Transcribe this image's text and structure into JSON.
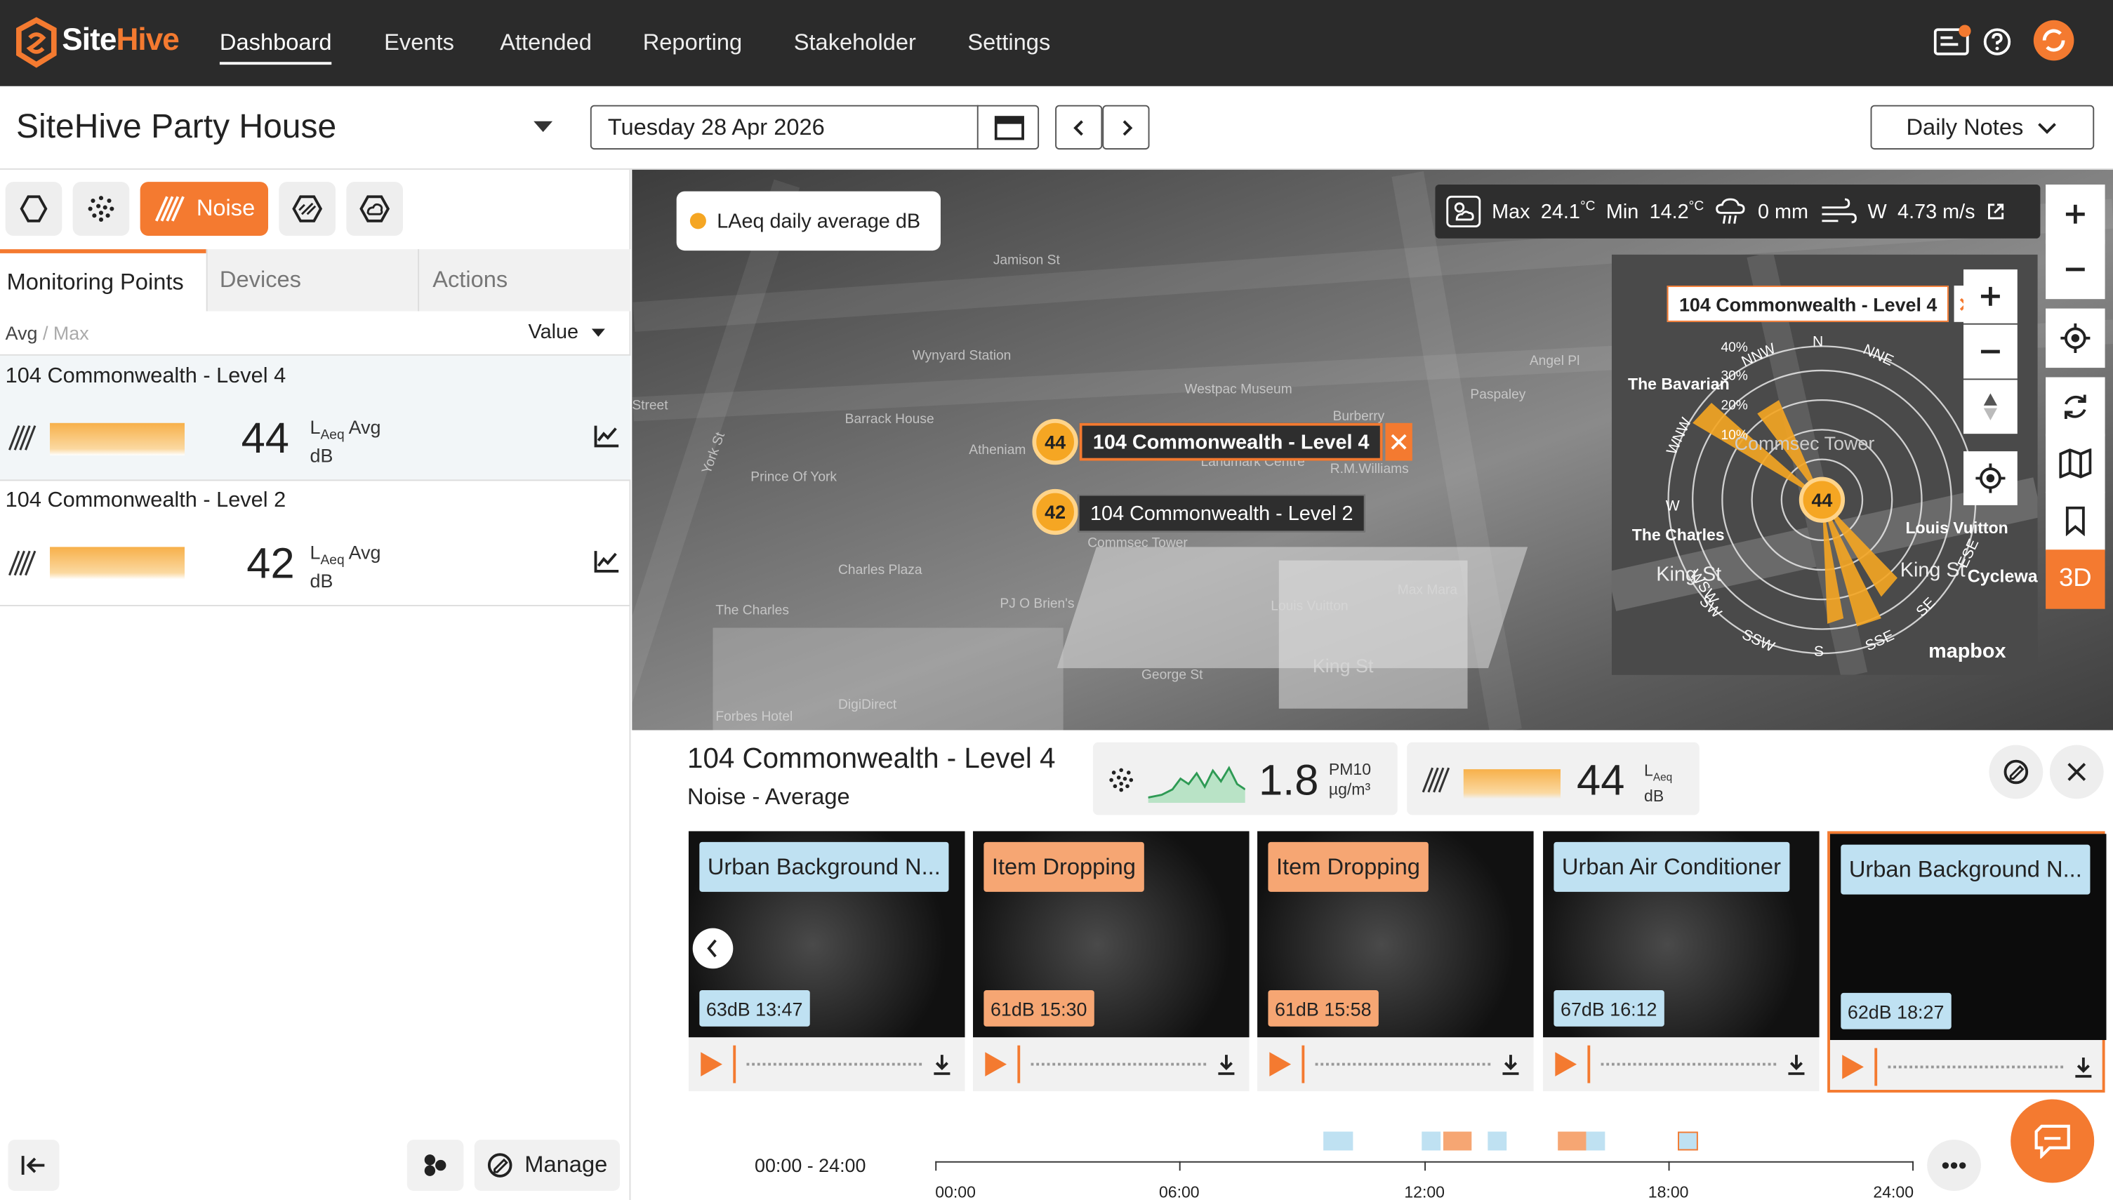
{
  "app": {
    "logo_site": "Site",
    "logo_hive": "Hive",
    "nav": [
      "Dashboard",
      "Events",
      "Attended",
      "Reporting",
      "Stakeholder",
      "Settings"
    ],
    "active_nav": "Dashboard"
  },
  "header": {
    "site_name": "SiteHive Party House",
    "date": "Tuesday 28 Apr 2026",
    "daily_notes": "Daily Notes"
  },
  "left": {
    "noise_btn": "Noise",
    "tabs": [
      "Monitoring Points",
      "Devices",
      "Actions"
    ],
    "avg": "Avg",
    "slash": " / ",
    "max": "Max",
    "value_sort": "Value",
    "points": [
      {
        "name": "104 Commonwealth - Level 4",
        "value": "44",
        "unit_a": "L",
        "unit_sub": "Aeq",
        "unit_b": " Avg",
        "unit_c": "dB"
      },
      {
        "name": "104 Commonwealth - Level 2",
        "value": "42",
        "unit_a": "L",
        "unit_sub": "Aeq",
        "unit_b": " Avg",
        "unit_c": "dB"
      }
    ],
    "manage": "Manage"
  },
  "map": {
    "legend": "LAeq daily average dB",
    "weather": {
      "max_label": "Max",
      "max_val": "24.1",
      "min_label": "Min",
      "min_val": "14.2",
      "deg": "°C",
      "rain": "0 mm",
      "wind_dir": "W",
      "wind": "4.73 m/s"
    },
    "pins": [
      {
        "value": "44",
        "label": "104 Commonwealth - Level 4"
      },
      {
        "value": "42",
        "label": "104 Commonwealth - Level 2"
      }
    ],
    "minimap_label": "104 Commonwealth - Level 4",
    "minimap_pin": "44",
    "ctl_3d": "3D",
    "street_labels": [
      "Jamison St",
      "Wynyard Station",
      "Barrack House",
      "Atheniam",
      "Prince Of York",
      "York St",
      "Charles Plaza",
      "The Charles",
      "PJ O Brien's",
      "Commsec Tower",
      "Louis Vuitton",
      "Max Mara",
      "King St",
      "George St",
      "Forbes Hotel",
      "DigiDirect",
      "Angel Pl",
      "Westpac Museum",
      "Burberry",
      "Paspaley",
      "Landmark Centre",
      "R.M.Williams",
      "Street"
    ],
    "minimap_labels": [
      "The Bavarian",
      "The Charles",
      "King St",
      "Louis Vuitton",
      "King St",
      "Cyclewa",
      "Commsec Tower",
      "mapbox"
    ],
    "compass": [
      "N",
      "NNE",
      "NNW",
      "WNW",
      "W",
      "WSW",
      "SW",
      "SSW",
      "S",
      "SSE",
      "SE",
      "ESE"
    ],
    "rings": [
      "40%",
      "30%",
      "20%",
      "10%"
    ]
  },
  "detail": {
    "title": "104 Commonwealth - Level 4",
    "subtitle": "Noise - Average",
    "pm_value": "1.8",
    "pm_label": "PM10",
    "pm_unit": "µg/m³",
    "noise_value": "44",
    "noise_label_a": "L",
    "noise_label_sub": "Aeq",
    "noise_unit": "dB",
    "cards": [
      {
        "tag": "Urban Background N...",
        "color": "blue",
        "db": "63dB 13:47"
      },
      {
        "tag": "Item Dropping",
        "color": "orange",
        "db": "61dB 15:30"
      },
      {
        "tag": "Item Dropping",
        "color": "orange",
        "db": "61dB 15:58"
      },
      {
        "tag": "Urban Air Conditioner",
        "color": "blue",
        "db": "67dB 16:12"
      },
      {
        "tag": "Urban Background N...",
        "color": "blue",
        "db": "62dB 18:27"
      }
    ],
    "time_range": "00:00 - 24:00",
    "ticks": [
      "00:00",
      "06:00",
      "12:00",
      "18:00",
      "24:00"
    ],
    "more": "•••"
  },
  "colors": {
    "brand": "#f47a30",
    "dark": "#2b2b2b",
    "pin": "#f5a623",
    "tag_blue": "#bfe1f2",
    "tag_orange": "#f6a673"
  }
}
